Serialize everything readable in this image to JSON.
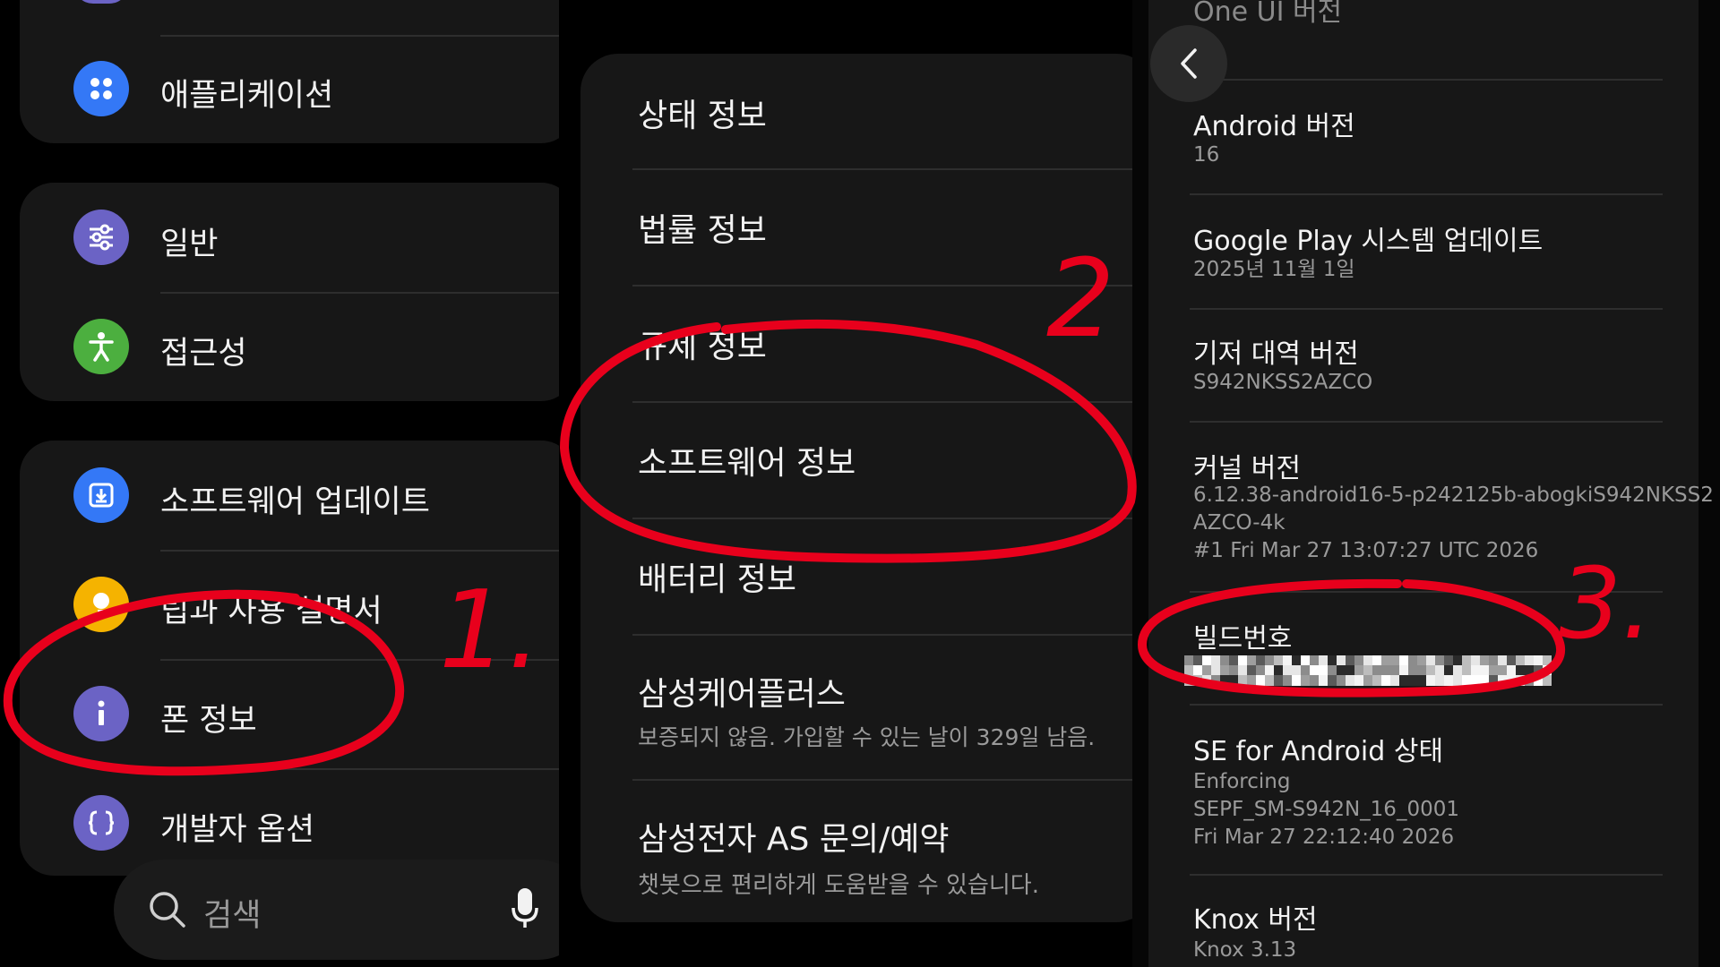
{
  "panel1": {
    "card1": {
      "apps_label": "애플리케이션"
    },
    "card2": {
      "general_label": "일반",
      "accessibility_label": "접근성"
    },
    "card3": {
      "software_update_label": "소프트웨어 업데이트",
      "tips_label": "팁과 사용 설명서",
      "phone_info_label": "폰 정보",
      "developer_label": "개발자 옵션"
    },
    "search": {
      "label": "검색"
    }
  },
  "panel2": {
    "items": [
      {
        "title": "상태 정보"
      },
      {
        "title": "법률 정보"
      },
      {
        "title": "규제 정보"
      },
      {
        "title": "소프트웨어 정보"
      },
      {
        "title": "배터리 정보"
      },
      {
        "title": "삼성케어플러스",
        "subtitle": "보증되지 않음. 가입할 수 있는 날이 329일 남음."
      },
      {
        "title": "삼성전자 AS 문의/예약",
        "subtitle": "챗봇으로 편리하게 도움받을 수 있습니다."
      }
    ]
  },
  "panel3": {
    "top_partial": "One UI 버전",
    "android": {
      "title": "Android 버전",
      "value": "16"
    },
    "gplay": {
      "title": "Google Play 시스템 업데이트",
      "value": "2025년 11월 1일"
    },
    "baseband": {
      "title": "기저 대역 버전",
      "value": "S942NKSS2AZCO"
    },
    "kernel": {
      "title": "커널 버전",
      "line1": "6.12.38-android16-5-p242125b-abogkiS942NKSS2",
      "line2": "AZCO-4k",
      "line3": "#1 Fri Mar 27 13:07:27 UTC 2026"
    },
    "build": {
      "title": "빌드번호"
    },
    "se": {
      "title": "SE for Android 상태",
      "line1": "Enforcing",
      "line2": "SEPF_SM-S942N_16_0001",
      "line3": "Fri Mar 27 22:12:40 2026"
    },
    "knox": {
      "title": "Knox 버전",
      "value": "Knox 3.13"
    }
  },
  "annotations": {
    "step1": "1.",
    "step2": "2",
    "step3": "3."
  },
  "colors": {
    "apps_icon": "#3478f6",
    "general_icon": "#6b63c5",
    "accessibility_icon": "#4caf3f",
    "update_icon": "#3478f6",
    "tips_icon": "#f5b300",
    "phone_info_icon": "#6b63c5",
    "developer_icon": "#6b63c5",
    "annotation_red": "#e8001c"
  }
}
